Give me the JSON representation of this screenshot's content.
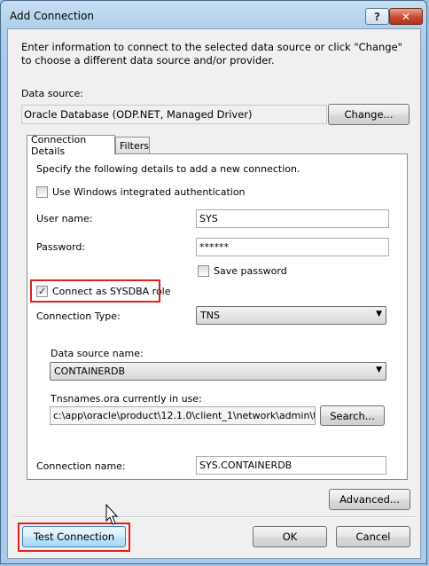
{
  "window": {
    "title": "Add Connection",
    "help_label": "?",
    "close_label": "✕"
  },
  "intro_text": "Enter information to connect to the selected data source or click \"Change\" to choose a different data source and/or provider.",
  "data_source": {
    "label": "Data source:",
    "value": "Oracle Database (ODP.NET, Managed Driver)",
    "change_label": "Change..."
  },
  "tabs": [
    {
      "label": "Connection Details"
    },
    {
      "label": "Filters"
    }
  ],
  "details": {
    "instruction": "Specify the following details to add a new connection.",
    "windows_auth_label": "Use Windows integrated authentication",
    "windows_auth_checked": false,
    "username_label": "User name:",
    "username_value": "SYS",
    "password_label": "Password:",
    "password_value": "******",
    "save_password_label": "Save password",
    "save_password_checked": false,
    "sysdba_label": "Connect as SYSDBA role",
    "sysdba_checked": true,
    "check_mark": "✓",
    "connection_type_label": "Connection Type:",
    "connection_type_value": "TNS",
    "ds_name_label": "Data source name:",
    "ds_name_value": "CONTAINERDB",
    "tnsnames_label": "Tnsnames.ora currently in use:",
    "tnsnames_value": "c:\\app\\oracle\\product\\12.1.0\\client_1\\network\\admin\\tnsnam",
    "search_label": "Search...",
    "connection_name_label": "Connection name:",
    "connection_name_value": "SYS.CONTAINERDB"
  },
  "buttons": {
    "advanced": "Advanced...",
    "test_connection": "Test Connection",
    "ok": "OK",
    "cancel": "Cancel"
  },
  "dropdown_arrow": "▼",
  "colors": {
    "highlight": "#e02020"
  }
}
